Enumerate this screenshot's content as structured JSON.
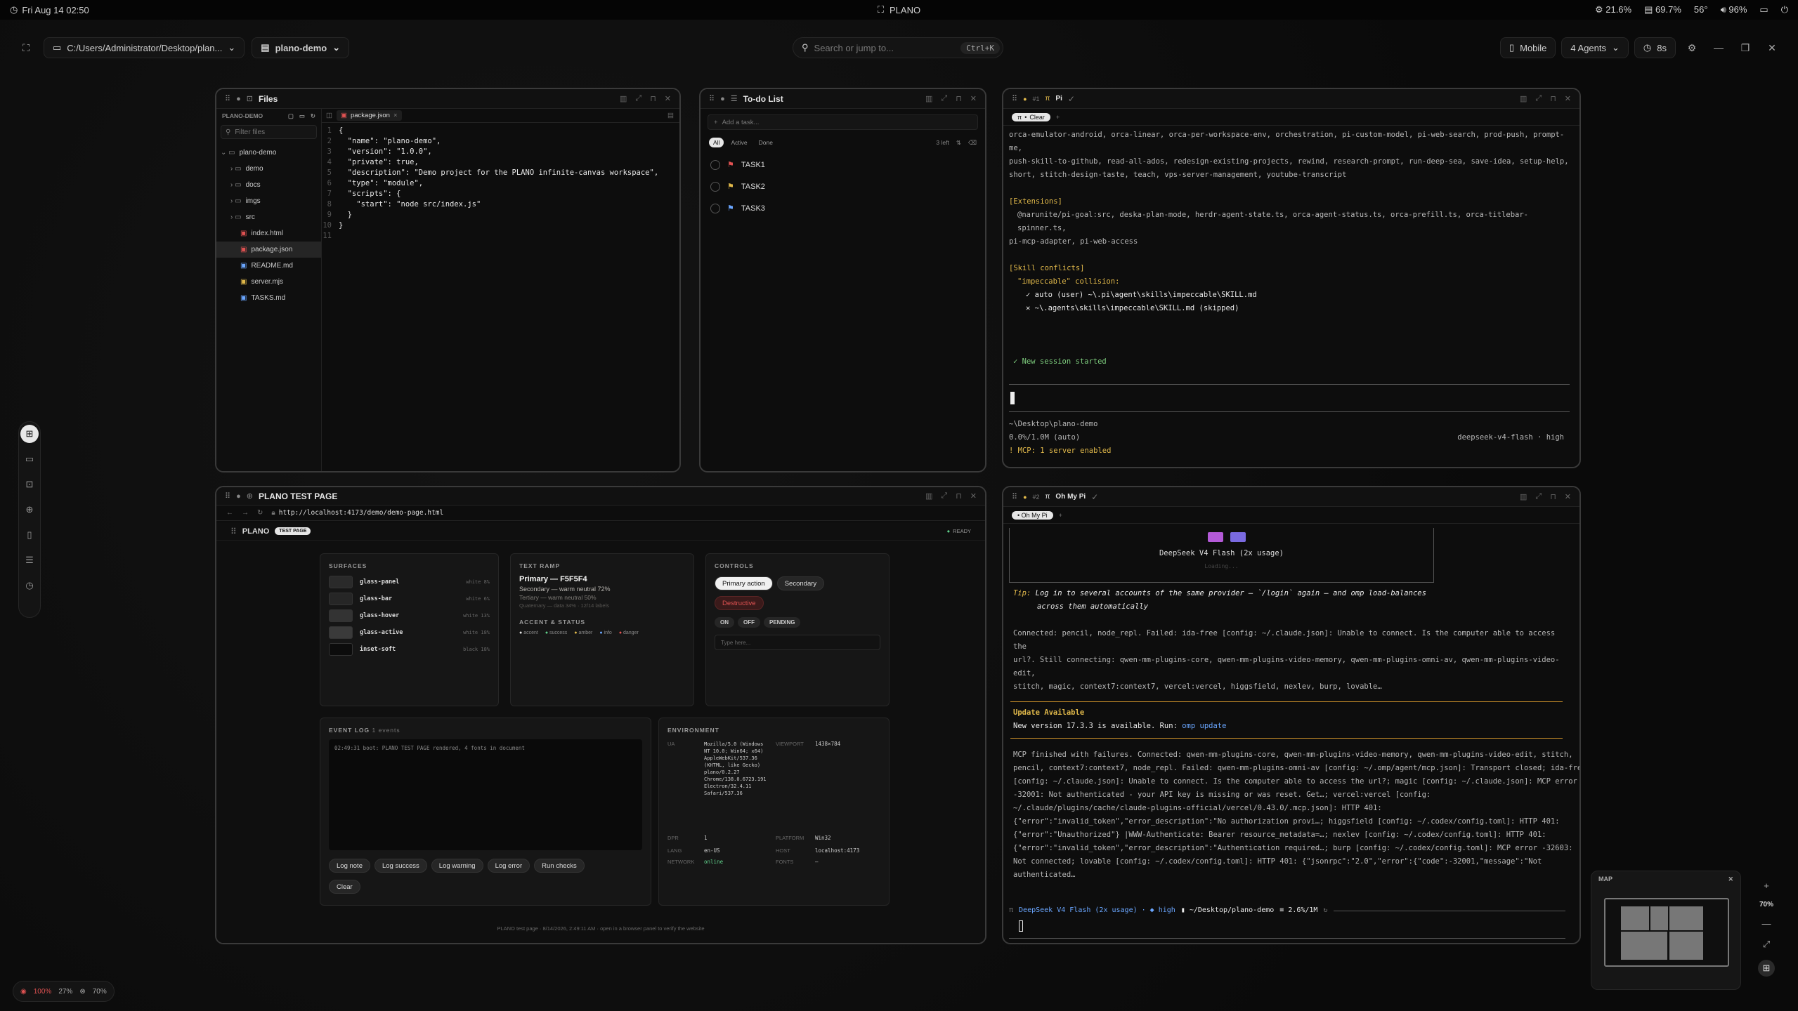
{
  "system": {
    "datetime": "Fri Aug 14 02:50",
    "app_name": "PLANO",
    "cpu": "21.6%",
    "memory": "69.7%",
    "temp": "56°",
    "volume": "96%"
  },
  "toolbar": {
    "path": "C:/Users/Administrator/Desktop/plan...",
    "workspace": "plano-demo",
    "search_placeholder": "Search or jump to...",
    "search_shortcut": "Ctrl+K",
    "mobile_label": "Mobile",
    "agents_label": "4 Agents",
    "timer_label": "8s"
  },
  "files_panel": {
    "title": "Files",
    "root_label": "PLANO-DEMO",
    "filter_placeholder": "Filter files",
    "open_tab": "package.json",
    "tree": [
      {
        "name": "plano-demo",
        "kind": "folder",
        "indent": 0
      },
      {
        "name": "demo",
        "kind": "folder",
        "indent": 1
      },
      {
        "name": "docs",
        "kind": "folder",
        "indent": 1
      },
      {
        "name": "imgs",
        "kind": "folder",
        "indent": 1
      },
      {
        "name": "src",
        "kind": "folder",
        "indent": 1
      },
      {
        "name": "index.html",
        "kind": "html",
        "indent": 1
      },
      {
        "name": "package.json",
        "kind": "json",
        "indent": 1
      },
      {
        "name": "README.md",
        "kind": "md",
        "indent": 1
      },
      {
        "name": "server.mjs",
        "kind": "js",
        "indent": 1
      },
      {
        "name": "TASKS.md",
        "kind": "md",
        "indent": 1
      }
    ],
    "code": [
      "{",
      "  \"name\": \"plano-demo\",",
      "  \"version\": \"1.0.0\",",
      "  \"private\": true,",
      "  \"description\": \"Demo project for the PLANO infinite-canvas workspace\",",
      "  \"type\": \"module\",",
      "  \"scripts\": {",
      "    \"start\": \"node src/index.js\"",
      "  }",
      "}",
      ""
    ]
  },
  "todo_panel": {
    "title": "To-do List",
    "add_placeholder": "Add a task...",
    "filters": [
      "All",
      "Active",
      "Done"
    ],
    "left_count": "3 left",
    "tasks": [
      {
        "label": "TASK1",
        "flag_color": "#e05252"
      },
      {
        "label": "TASK2",
        "flag_color": "#e0b84a"
      },
      {
        "label": "TASK3",
        "flag_color": "#6aa6ff"
      }
    ]
  },
  "pi_panel": {
    "tab_index": "#1",
    "title": "Pi",
    "session_tab": "Clear",
    "skills_line1": "orca-emulator-android, orca-linear, orca-per-workspace-env, orchestration, pi-custom-model, pi-web-search, prod-push, prompt-me,",
    "skills_line2": "push-skill-to-github, read-all-ados, redesign-existing-projects, rewind, research-prompt, run-deep-sea, save-idea, setup-help,",
    "skills_line3": "short, stitch-design-taste, teach, vps-server-management, youtube-transcript",
    "extensions_heading": "[Extensions]",
    "extensions_line1": "@narunite/pi-goal:src, deska-plan-mode, herdr-agent-state.ts, orca-agent-status.ts, orca-prefill.ts, orca-titlebar-spinner.ts,",
    "extensions_line2": "pi-mcp-adapter, pi-web-access",
    "conflicts_heading": "[Skill conflicts]",
    "conflict_name": "\"impeccable\" collision:",
    "conflict_ok": "✓ auto (user) ~\\.pi\\agent\\skills\\impeccable\\SKILL.md",
    "conflict_skip": "✕ ~\\.agents\\skills\\impeccable\\SKILL.md (skipped)",
    "session_started": "✓ New session started",
    "cwd": "~\\Desktop\\plano-demo",
    "usage": "0.0%/1.0M (auto)",
    "model": "deepseek-v4-flash · high",
    "mcp": "MCP: 1 server enabled"
  },
  "browser_panel": {
    "title": "PLANO TEST PAGE",
    "url": "http://localhost:4173/demo/demo-page.html",
    "brand": "PLANO",
    "badge": "TEST PAGE",
    "ready": "READY",
    "surfaces_heading": "SURFACES",
    "surfaces": [
      {
        "name": "glass-panel",
        "note": "white 8%"
      },
      {
        "name": "glass-bar",
        "note": "white 6%"
      },
      {
        "name": "glass-hover",
        "note": "white 13%"
      },
      {
        "name": "glass-active",
        "note": "white 18%"
      },
      {
        "name": "inset-soft",
        "note": "black 18%"
      }
    ],
    "text_ramp_heading": "TEXT RAMP",
    "primary_text": "Primary — F5F5F4",
    "secondary_text": "Secondary — warm neutral 72%",
    "tertiary_text": "Tertiary — warm neutral 50%",
    "quaternary_text": "Quaternary — data 34% · 12/14 labels",
    "accent_heading": "ACCENT & STATUS",
    "accents": [
      {
        "label": "accent",
        "color": "#e6e6e6"
      },
      {
        "label": "success",
        "color": "#5fcf8a"
      },
      {
        "label": "amber",
        "color": "#e0b84a"
      },
      {
        "label": "info",
        "color": "#6aa6ff"
      },
      {
        "label": "danger",
        "color": "#e05252"
      }
    ],
    "controls_heading": "CONTROLS",
    "primary_btn": "Primary action",
    "secondary_btn": "Secondary",
    "destructive_btn": "Destructive",
    "chip_on": "ON",
    "chip_off": "OFF",
    "chip_pending": "PENDING",
    "type_placeholder": "Type here...",
    "event_log_heading": "EVENT LOG",
    "event_count": "1 events",
    "event_line": "02:49:31 boot: PLANO TEST PAGE rendered, 4 fonts in document",
    "log_buttons": [
      "Log note",
      "Log success",
      "Log warning",
      "Log error",
      "Run checks"
    ],
    "clear_btn": "Clear",
    "env_heading": "ENVIRONMENT",
    "env_ua_label": "UA",
    "env_ua": "Mozilla/5.0 (Windows NT 10.0; Win64; x64) AppleWebKit/537.36 (KHTML, like Gecko) plano/0.2.27 Chrome/138.0.6723.191 Electron/32.4.11 Safari/537.36",
    "env_viewport_label": "VIEWPORT",
    "env_viewport": "1438×784",
    "env_dpr_label": "DPR",
    "env_dpr": "1",
    "env_platform_label": "PLATFORM",
    "env_platform": "Win32",
    "env_lang_label": "LANG",
    "env_lang": "en-US",
    "env_host_label": "HOST",
    "env_host": "localhost:4173",
    "env_network_label": "NETWORK",
    "env_network": "online",
    "env_fonts_label": "FONTS",
    "env_fonts": "—",
    "footer": "PLANO test page · 8/14/2026, 2:49:11 AM · open in a browser panel to verify the website"
  },
  "omp_panel": {
    "tab_index": "#2",
    "title": "Oh My Pi",
    "session_tab": "Oh My Pi",
    "banner_model": "DeepSeek V4 Flash (2x usage)",
    "banner_sub": "Loading...",
    "tip_label": "Tip:",
    "tip_line1": "Log in to several accounts of the same provider — `/login` again — and omp load-balances",
    "tip_line2": "across them automatically",
    "connected_line1": "Connected: pencil, node_repl. Failed: ida-free [config: ~/.claude.json]: Unable to connect. Is the computer able to access the",
    "connected_line2": "url?. Still connecting: qwen-mm-plugins-core, qwen-mm-plugins-video-memory, qwen-mm-plugins-omni-av, qwen-mm-plugins-video-edit,",
    "connected_line3": "stitch, magic, context7:context7, vercel:vercel, higgsfield, nexlev, burp, lovable…",
    "update_heading": "Update Available",
    "update_text": "New version 17.3.3 is available. Run:",
    "update_cmd": "omp update",
    "mcp_lines": [
      "MCP finished with failures. Connected: qwen-mm-plugins-core, qwen-mm-plugins-video-memory, qwen-mm-plugins-video-edit, stitch,",
      "pencil, context7:context7, node_repl. Failed: qwen-mm-plugins-omni-av [config: ~/.omp/agent/mcp.json]: Transport closed; ida-free",
      "[config: ~/.claude.json]: Unable to connect. Is the computer able to access the url?; magic [config: ~/.claude.json]: MCP error",
      "-32001: Not authenticated - your API key is missing or was reset. Get…; vercel:vercel [config:",
      "~/.claude/plugins/cache/claude-plugins-official/vercel/0.43.0/.mcp.json]: HTTP 401:",
      "{\"error\":\"invalid_token\",\"error_description\":\"No authorization provi…; higgsfield [config: ~/.codex/config.toml]: HTTP 401:",
      "{\"error\":\"Unauthorized\"} |WWW-Authenticate: Bearer resource_metadata=…; nexlev [config: ~/.codex/config.toml]: HTTP 401:",
      "{\"error\":\"invalid_token\",\"error_description\":\"Authentication required…; burp [config: ~/.codex/config.toml]: MCP error -32603:",
      "Not connected; lovable [config: ~/.codex/config.toml]: HTTP 401: {\"jsonrpc\":\"2.0\",\"error\":{\"code\":-32001,\"message\":\"Not",
      "authenticated…"
    ],
    "status_model": "DeepSeek V4 Flash (2x usage) · ◆ high",
    "status_path": "~/Desktop/plano-demo",
    "status_usage": "2.6%/1M"
  },
  "minimap": {
    "title": "MAP",
    "zoom": "70%"
  },
  "bottom_status": {
    "zoom_a": "100%",
    "zoom_b": "27%",
    "zoom_c": "70%"
  }
}
